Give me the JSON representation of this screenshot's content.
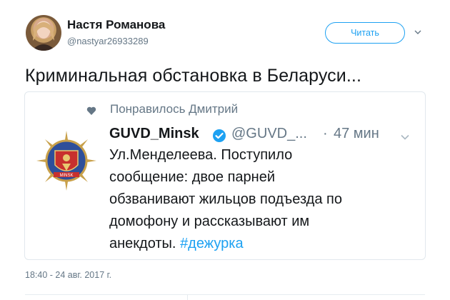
{
  "author": {
    "name": "Настя Романова",
    "handle": "@nastyar26933289"
  },
  "follow_button": "Читать",
  "tweet_text": "Криминальная обстановка в Беларуси...",
  "quoted": {
    "liked_by": "Понравилось Дмитрий",
    "name": "GUVD_Minsk",
    "handle": "@GUVD_...",
    "dot": "·",
    "time": "47 мин",
    "lines": [
      "Ул.Менделеева. Поступило",
      "сообщение: двое парней",
      "обзванивают жильцов подъезда по",
      "домофону и рассказывают им"
    ],
    "last_line": "анекдоты.",
    "hashtag": "#дежурка"
  },
  "timestamp": "18:40 - 24 авг. 2017 г.",
  "colors": {
    "accent": "#1da1f2",
    "muted": "#657786",
    "text": "#14171a",
    "border": "#e1e8ed"
  },
  "icons": [
    "avatar",
    "chevron-down-icon",
    "heart-icon",
    "guvd-logo",
    "verified-badge-icon"
  ]
}
